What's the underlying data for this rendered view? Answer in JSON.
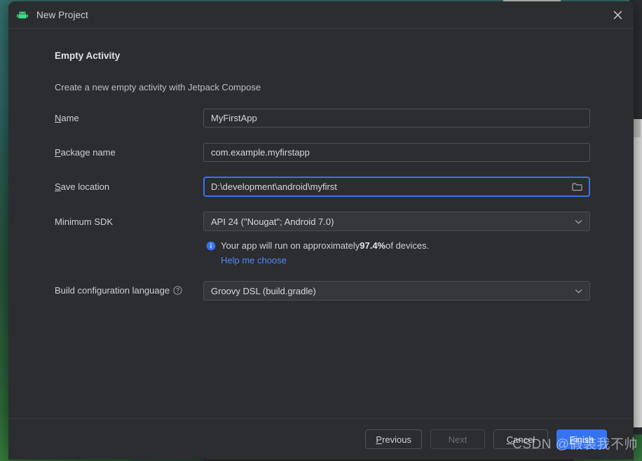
{
  "window": {
    "title": "New Project",
    "app_icon": "android-icon",
    "close_icon": "close-icon"
  },
  "header": {
    "title": "Empty Activity",
    "subtitle": "Create a new empty activity with Jetpack Compose"
  },
  "form": {
    "name": {
      "label_mnemonic": "N",
      "label_rest": "ame",
      "value": "MyFirstApp",
      "type": "text"
    },
    "package_name": {
      "label_mnemonic": "P",
      "label_rest": "ackage name",
      "value": "com.example.myfirstapp",
      "type": "text"
    },
    "save_location": {
      "label_mnemonic": "S",
      "label_rest": "ave location",
      "value": "D:\\development\\android\\myfirst",
      "type": "text",
      "focused": true,
      "browse_icon": "folder-icon"
    },
    "minimum_sdk": {
      "label": "Minimum SDK",
      "value": "API 24 (\"Nougat\"; Android 7.0)",
      "type": "combobox",
      "chevron_icon": "chevron-down-icon"
    },
    "build_configuration_language": {
      "label": "Build configuration language",
      "help_icon": "help-circle-icon",
      "value": "Groovy DSL (build.gradle)",
      "type": "combobox",
      "chevron_icon": "chevron-down-icon"
    }
  },
  "info": {
    "icon": "info-icon",
    "text_before": "Your app will run on approximately ",
    "percent": "97.4%",
    "text_after": " of devices.",
    "link": "Help me choose"
  },
  "buttons": {
    "previous": {
      "mnemonic": "P",
      "rest": "revious",
      "enabled": true
    },
    "next": {
      "label": "Next",
      "enabled": false
    },
    "cancel": {
      "mnemonic": "C",
      "rest": "ancel",
      "enabled": true
    },
    "finish": {
      "mnemonic": "F",
      "rest": "inish",
      "enabled": true,
      "primary": true
    }
  },
  "watermark": "CSDN @假装我不帅",
  "colors": {
    "dialog_bg": "#2b2d30",
    "accent_blue": "#3574f0",
    "link_blue": "#548af7",
    "android_green": "#3ddc84",
    "text_primary": "#ced0d6"
  }
}
